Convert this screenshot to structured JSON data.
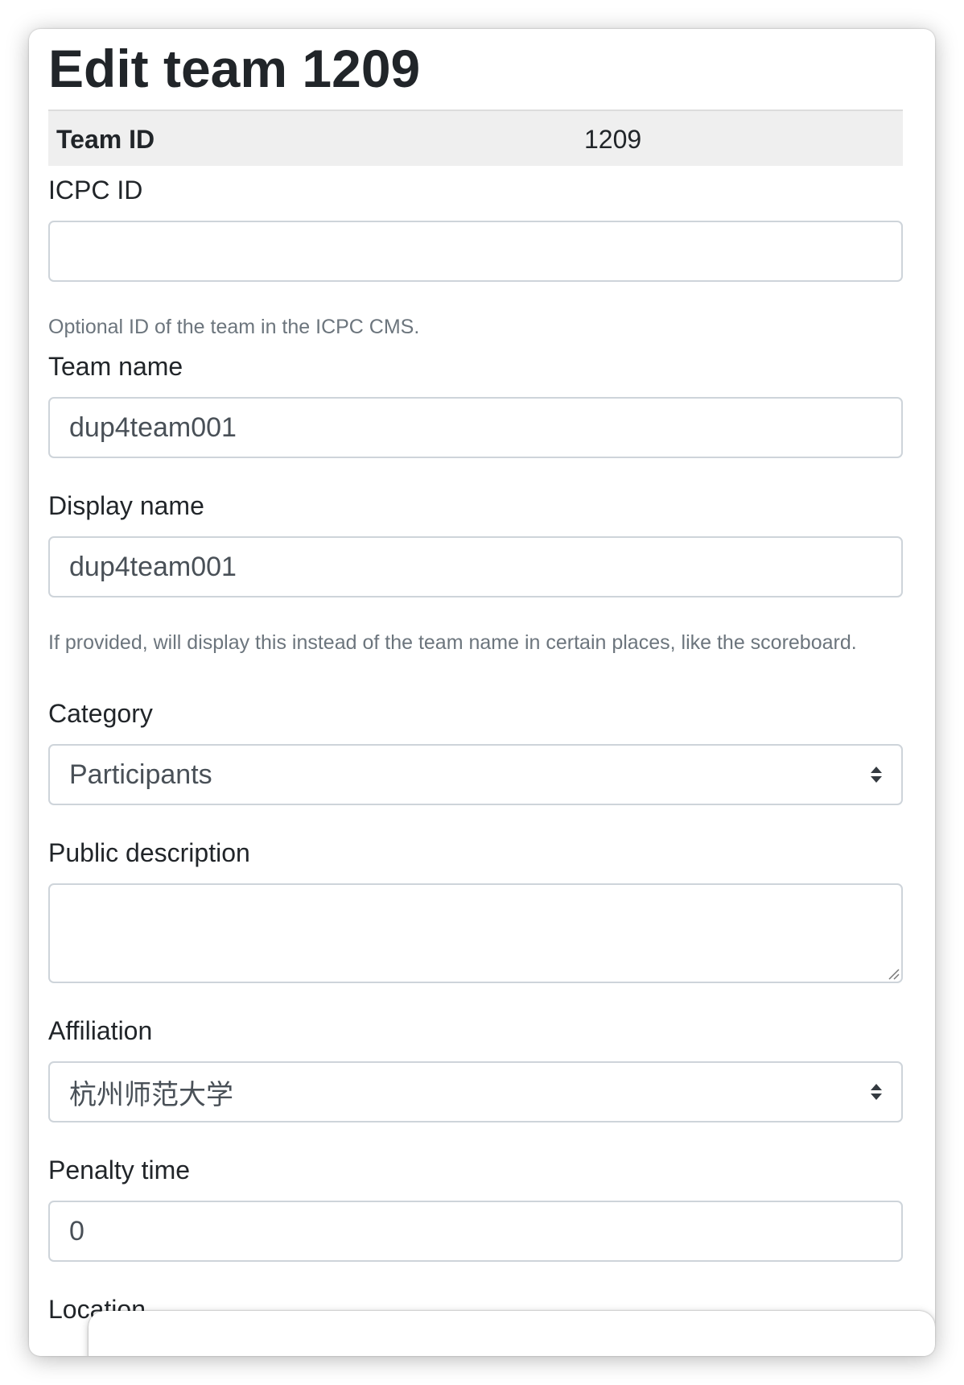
{
  "page": {
    "title": "Edit team 1209"
  },
  "team_id": {
    "label": "Team ID",
    "value": "1209"
  },
  "icpc_id": {
    "label": "ICPC ID",
    "value": "",
    "help": "Optional ID of the team in the ICPC CMS."
  },
  "team_name": {
    "label": "Team name",
    "value": "dup4team001"
  },
  "display_name": {
    "label": "Display name",
    "value": "dup4team001",
    "help": "If provided, will display this instead of the team name in certain places, like the scoreboard."
  },
  "category": {
    "label": "Category",
    "selected": "Participants"
  },
  "public_description": {
    "label": "Public description",
    "value": ""
  },
  "affiliation": {
    "label": "Affiliation",
    "selected": "杭州师范大学"
  },
  "penalty_time": {
    "label": "Penalty time",
    "value": "0"
  },
  "location": {
    "label": "Location"
  },
  "icons": {
    "select_arrow": "updown-caret-icon",
    "resize": "resize-grip-icon"
  },
  "colors": {
    "border": "#ced4da",
    "help_text": "#6c757d",
    "table_bg": "#efefef"
  }
}
